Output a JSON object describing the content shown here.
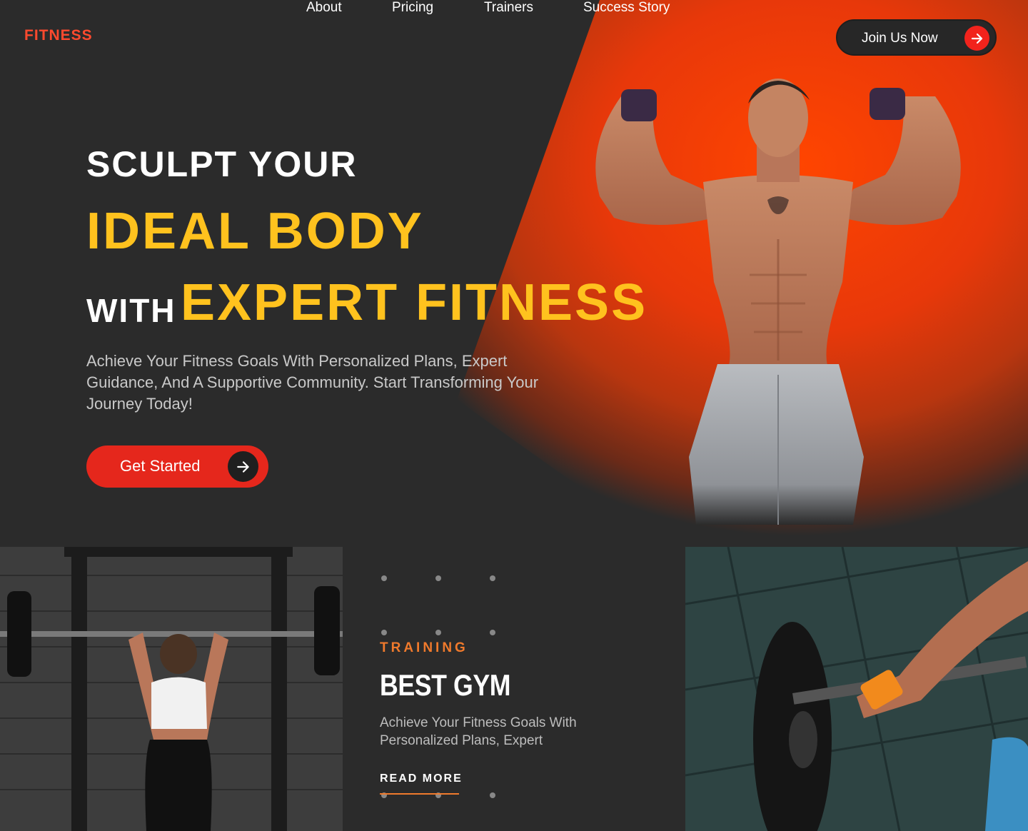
{
  "brand": {
    "logo": "FITNESS",
    "accent": "#ff4a2e",
    "highlight": "#ffc21e",
    "button_red": "#e5271c"
  },
  "nav": {
    "items": [
      {
        "label": "About"
      },
      {
        "label": "Pricing"
      },
      {
        "label": "Trainers"
      },
      {
        "label": "Success Story"
      }
    ],
    "join_label": "Join Us Now"
  },
  "hero": {
    "line1": "SCULPT YOUR",
    "line2": "IDEAL BODY",
    "with": "WITH",
    "line3": "EXPERT FITNESS",
    "subtitle": "Achieve Your Fitness Goals With Personalized Plans, Expert Guidance, And A Supportive Community. Start Transforming Your Journey Today!",
    "cta_label": "Get Started"
  },
  "card": {
    "tag": "TRAINING",
    "title": "BEST GYM",
    "text": "Achieve Your Fitness Goals With Personalized Plans, Expert",
    "read_more": "READ MORE"
  },
  "icons": {
    "join_arrow": "arrow-right-icon",
    "cta_arrow": "arrow-right-icon"
  }
}
